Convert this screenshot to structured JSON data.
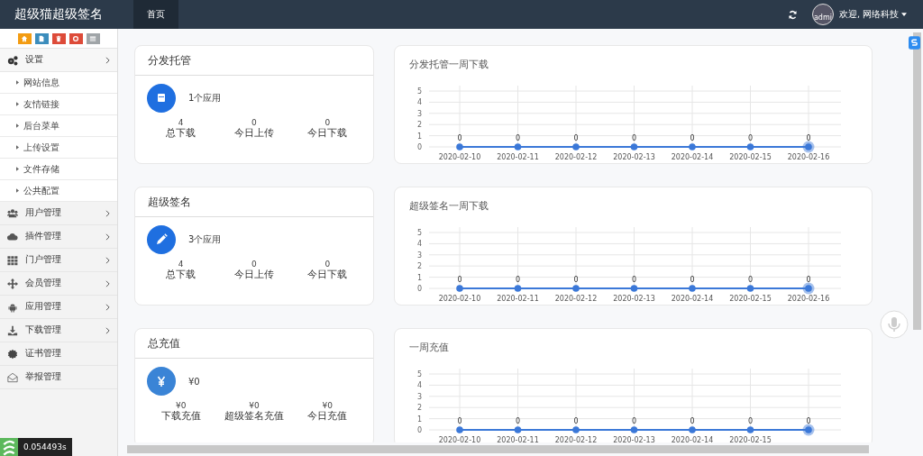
{
  "header": {
    "brand": "超级猫超级签名",
    "tabs": [
      {
        "label": "首页",
        "selected": true
      }
    ],
    "avatar_text": "admi",
    "welcome": "欢迎, 网络科技"
  },
  "sidebar": {
    "tools": [
      {
        "kind": "home",
        "color": "#f39c12"
      },
      {
        "kind": "file",
        "color": "#3c8dbc"
      },
      {
        "kind": "trash",
        "color": "#dd4b39"
      },
      {
        "kind": "recycle",
        "color": "#dd4b39"
      },
      {
        "kind": "list",
        "color": "#a0a5a8"
      }
    ],
    "items": [
      {
        "label": "设置",
        "kind": "gears",
        "expandable": true,
        "children": [
          {
            "label": "网站信息"
          },
          {
            "label": "友情链接"
          },
          {
            "label": "后台菜单"
          },
          {
            "label": "上传设置"
          },
          {
            "label": "文件存储"
          },
          {
            "label": "公共配置"
          }
        ]
      },
      {
        "label": "用户管理",
        "kind": "users",
        "expandable": true
      },
      {
        "label": "插件管理",
        "kind": "cloud",
        "expandable": true
      },
      {
        "label": "门户管理",
        "kind": "grid",
        "expandable": true
      },
      {
        "label": "会员管理",
        "kind": "move",
        "expandable": true
      },
      {
        "label": "应用管理",
        "kind": "android",
        "expandable": true
      },
      {
        "label": "下载管理",
        "kind": "download",
        "expandable": true
      },
      {
        "label": "证书管理",
        "kind": "cert",
        "expandable": false
      },
      {
        "label": "举报管理",
        "kind": "envelope",
        "expandable": false
      }
    ],
    "timer": "0.054493s"
  },
  "sections": [
    {
      "title": "分发托管",
      "kind": "calendar",
      "summary": "1个应用",
      "stats": [
        {
          "value": "4",
          "label": "总下载"
        },
        {
          "value": "0",
          "label": "今日上传"
        },
        {
          "value": "0",
          "label": "今日下载"
        }
      ],
      "chart_data": {
        "type": "line",
        "title": "分发托管一周下载",
        "categories": [
          "2020-02-10",
          "2020-02-11",
          "2020-02-12",
          "2020-02-13",
          "2020-02-14",
          "2020-02-15",
          "2020-02-16"
        ],
        "series": [
          {
            "color": "#3b78d8",
            "marker": "circle",
            "values": [
              0,
              0,
              0,
              0,
              0,
              0,
              0
            ]
          }
        ],
        "ylim": [
          0,
          5
        ],
        "yticks": [
          0,
          1,
          2,
          3,
          4,
          5
        ],
        "grid": true,
        "data_labels": true
      }
    },
    {
      "title": "超级签名",
      "kind": "pencil",
      "summary": "3个应用",
      "stats": [
        {
          "value": "4",
          "label": "总下载"
        },
        {
          "value": "0",
          "label": "今日上传"
        },
        {
          "value": "0",
          "label": "今日下载"
        }
      ],
      "chart_data": {
        "type": "line",
        "title": "超级签名一周下载",
        "categories": [
          "2020-02-10",
          "2020-02-11",
          "2020-02-12",
          "2020-02-13",
          "2020-02-14",
          "2020-02-15",
          "2020-02-16"
        ],
        "series": [
          {
            "color": "#3b78d8",
            "marker": "circle",
            "values": [
              0,
              0,
              0,
              0,
              0,
              0,
              0
            ]
          }
        ],
        "ylim": [
          0,
          5
        ],
        "yticks": [
          0,
          1,
          2,
          3,
          4,
          5
        ],
        "grid": true,
        "data_labels": true
      }
    },
    {
      "title": "总充值",
      "kind": "yen",
      "summary": "¥0",
      "stats": [
        {
          "value": "¥0",
          "label": "下载充值"
        },
        {
          "value": "¥0",
          "label": "超级签名充值"
        },
        {
          "value": "¥0",
          "label": "今日充值"
        }
      ],
      "chart_data": {
        "type": "line",
        "title": "一周充值",
        "categories": [
          "2020-02-10",
          "2020-02-11",
          "2020-02-12",
          "2020-02-13",
          "2020-02-14",
          "2020-02-15",
          null
        ],
        "series": [
          {
            "color": "#3b78d8",
            "marker": "circle",
            "values": [
              0,
              0,
              0,
              0,
              0,
              0,
              0
            ]
          }
        ],
        "ylim": [
          0,
          5
        ],
        "yticks": [
          0,
          1,
          2,
          3,
          4,
          5
        ],
        "grid": true,
        "data_labels": true
      }
    }
  ]
}
